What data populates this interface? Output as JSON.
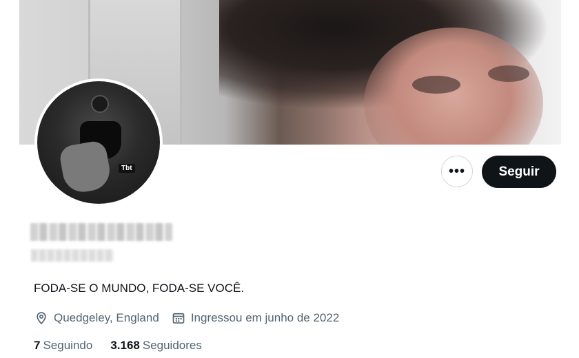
{
  "profile": {
    "avatar_badge": "Tbt",
    "bio": "FODA-SE O MUNDO, FODA-SE VOCÊ.",
    "location": "Quedgeley, England",
    "joined": "Ingressou em junho de 2022"
  },
  "actions": {
    "more_label": "•••",
    "follow_label": "Seguir"
  },
  "stats": {
    "following_count": "7",
    "following_label": "Seguindo",
    "followers_count": "3.168",
    "followers_label": "Seguidores"
  },
  "icons": {
    "location": "location-pin-icon",
    "calendar": "calendar-icon",
    "more": "more-options-icon"
  },
  "colors": {
    "follow_button_bg": "#0f1419",
    "secondary_text": "#536471",
    "primary_text": "#0f1419"
  }
}
